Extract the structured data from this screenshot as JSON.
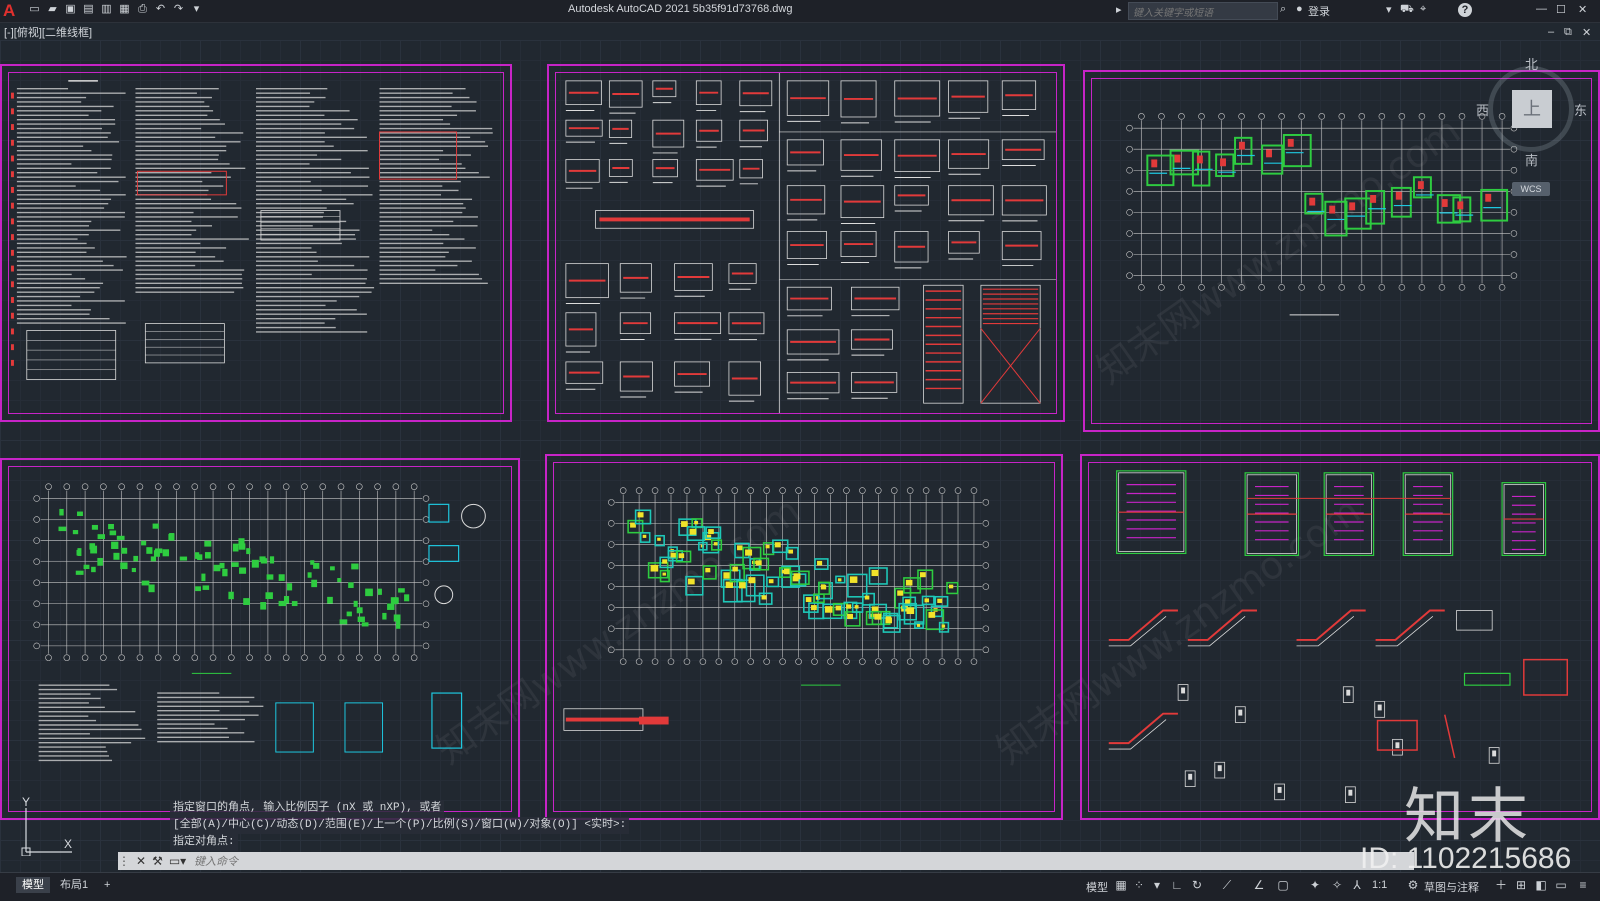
{
  "app": {
    "logo": "A",
    "title": "Autodesk AutoCAD 2021     5b35f91d73768.dwg",
    "search_placeholder": "键入关键字或短语",
    "login_label": "登录",
    "help_label": "?"
  },
  "viewport": {
    "label": "[-][俯视][二维线框]",
    "navcube": {
      "top_face": "上",
      "north": "北",
      "south": "南",
      "east": "东",
      "west": "西",
      "wcs": "WCS"
    }
  },
  "command": {
    "history": [
      "指定窗口的角点, 输入比例因子 (nX 或 nXP), 或者",
      "[全部(A)/中心(C)/动态(D)/范围(E)/上一个(P)/比例(S)/窗口(W)/对象(O)] <实时>:",
      "指定对角点:"
    ],
    "input_placeholder": "键入命令"
  },
  "layout_tabs": [
    {
      "label": "模型",
      "active": true
    },
    {
      "label": "布局1",
      "active": false
    },
    {
      "label": "+",
      "active": false
    }
  ],
  "statusbar": {
    "model_label": "模型",
    "scale_label": "1:1",
    "workspace_label": "草图与注释"
  },
  "watermark": {
    "logo_text": "知末",
    "id_text": "ID: 1102215686",
    "diagonal_text": "知末网www.znzmo.com"
  },
  "sheets": [
    {
      "id": "design-notes",
      "accent": "#e23a3a"
    },
    {
      "id": "details",
      "accent": "#e23a3a"
    },
    {
      "id": "column-plan",
      "accent": "#2ecc40"
    },
    {
      "id": "foundation-plan",
      "accent": "#2ecc40"
    },
    {
      "id": "slab-plan",
      "accent": "#f1e32a"
    },
    {
      "id": "stair-details",
      "accent": "#2ecc40"
    }
  ],
  "colors": {
    "sheet_border": "#c724c7",
    "grid_background": "#212830",
    "titlebar": "#1e2128"
  }
}
